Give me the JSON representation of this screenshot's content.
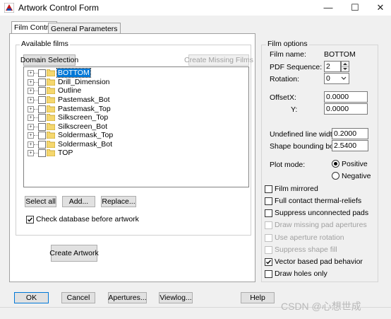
{
  "window": {
    "title": "Artwork Control Form",
    "minimize_glyph": "—",
    "maximize_glyph": "☐",
    "close_glyph": "✕"
  },
  "tabs": [
    {
      "label": "Film Control",
      "active": true
    },
    {
      "label": "General Parameters",
      "active": false
    }
  ],
  "available_films": {
    "group_label": "Available films",
    "domain_button": "Domain Selection",
    "create_missing_button": "Create Missing Films",
    "films": [
      "BOTTOM",
      "Drill_Dimension",
      "Outline",
      "Pastemask_Bot",
      "Pastemask_Top",
      "Silkscreen_Top",
      "Silkscreen_Bot",
      "Soldermask_Top",
      "Soldermask_Bot",
      "TOP"
    ],
    "selected_film": "BOTTOM",
    "select_all_button": "Select all",
    "add_button": "Add...",
    "replace_button": "Replace...",
    "check_db_label": "Check database before artwork",
    "check_db_checked": true,
    "create_artwork_button": "Create Artwork"
  },
  "film_options": {
    "group_label": "Film options",
    "film_name_label": "Film name:",
    "film_name_value": "BOTTOM",
    "pdf_sequence_label": "PDF Sequence:",
    "pdf_sequence_value": "2",
    "rotation_label": "Rotation:",
    "rotation_value": "0",
    "offset_label": "Offset",
    "offset_x_label": "X:",
    "offset_x_value": "0.0000",
    "offset_y_label": "Y:",
    "offset_y_value": "0.0000",
    "undefined_line_width_label": "Undefined line width:",
    "undefined_line_width_value": "0.2000",
    "shape_bounding_box_label": "Shape bounding box:",
    "shape_bounding_box_value": "2.5400",
    "plot_mode_label": "Plot mode:",
    "plot_mode_positive": "Positive",
    "plot_mode_negative": "Negative",
    "plot_mode_selected": "Positive",
    "checkboxes": [
      {
        "label": "Film mirrored",
        "checked": false,
        "enabled": true
      },
      {
        "label": "Full contact thermal-reliefs",
        "checked": false,
        "enabled": true
      },
      {
        "label": "Suppress unconnected pads",
        "checked": false,
        "enabled": true
      },
      {
        "label": "Draw missing pad apertures",
        "checked": false,
        "enabled": false
      },
      {
        "label": "Use aperture rotation",
        "checked": false,
        "enabled": false
      },
      {
        "label": "Suppress shape fill",
        "checked": false,
        "enabled": false
      },
      {
        "label": "Vector based pad behavior",
        "checked": true,
        "enabled": true
      },
      {
        "label": "Draw holes only",
        "checked": false,
        "enabled": true
      }
    ]
  },
  "bottom_buttons": {
    "ok": "OK",
    "cancel": "Cancel",
    "apertures": "Apertures...",
    "viewlog": "Viewlog...",
    "help": "Help"
  },
  "watermark": "CSDN @心想世成",
  "colors": {
    "selection": "#0078d7",
    "folder": "#f5d76e",
    "folder_edge": "#b8941e"
  }
}
